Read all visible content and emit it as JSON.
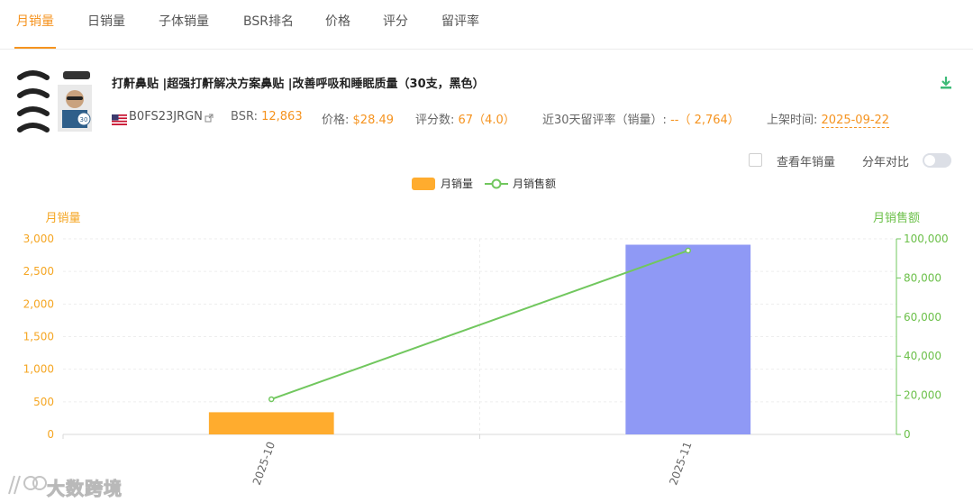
{
  "tabs": [
    {
      "label": "月销量",
      "active": true
    },
    {
      "label": "日销量",
      "active": false
    },
    {
      "label": "子体销量",
      "active": false
    },
    {
      "label": "BSR排名",
      "active": false
    },
    {
      "label": "价格",
      "active": false
    },
    {
      "label": "评分",
      "active": false
    },
    {
      "label": "留评率",
      "active": false
    }
  ],
  "product": {
    "title": "打鼾鼻贴 |超强打鼾解决方案鼻贴 |改善呼吸和睡眠质量（30支，黑色）",
    "asin": "B0FS23JRGN",
    "bsr_label": "BSR:",
    "bsr_value": "12,863",
    "price_label": "价格:",
    "price_value": "$28.49",
    "rating_label": "评分数:",
    "rating_value": "67（4.0）",
    "review_rate_label": "近30天留评率（销量）:",
    "review_rate_value": "--（ 2,764）",
    "listed_label": "上架时间:",
    "listed_value": "2025-09-22",
    "thumb_badge": "30"
  },
  "controls": {
    "yearly_label": "查看年销量",
    "yearly_checked": false,
    "yoy_label": "分年对比",
    "yoy_on": false
  },
  "colors": {
    "accent": "#f5931f",
    "bar_primary": "#ffac2e",
    "bar_secondary": "#8f99f5",
    "line": "#71c75e",
    "left_axis_text": "#f5a623",
    "right_axis_text": "#6cc04a"
  },
  "chart_data": {
    "type": "bar",
    "categories": [
      "2025-10",
      "2025-11"
    ],
    "legend": [
      "月销量",
      "月销售额"
    ],
    "legend_position": "top-center",
    "series": [
      {
        "name": "月销量",
        "type": "bar",
        "axis": "left",
        "values": [
          340,
          2910
        ],
        "colors": [
          "#ffac2e",
          "#8f99f5"
        ]
      },
      {
        "name": "月销售额",
        "type": "line",
        "axis": "right",
        "values": [
          18000,
          94000
        ],
        "color": "#71c75e"
      }
    ],
    "ylabel_left": "月销量",
    "ylabel_right": "月销售额",
    "ylim_left": [
      0,
      3000
    ],
    "ylim_right": [
      0,
      100000
    ],
    "yticks_left": [
      "0",
      "500",
      "1,000",
      "1,500",
      "2,000",
      "2,500",
      "3,000"
    ],
    "yticks_right": [
      "0",
      "20,000",
      "40,000",
      "60,000",
      "80,000",
      "100,000"
    ],
    "grid": true
  },
  "watermark": {
    "text": "大数跨境"
  }
}
